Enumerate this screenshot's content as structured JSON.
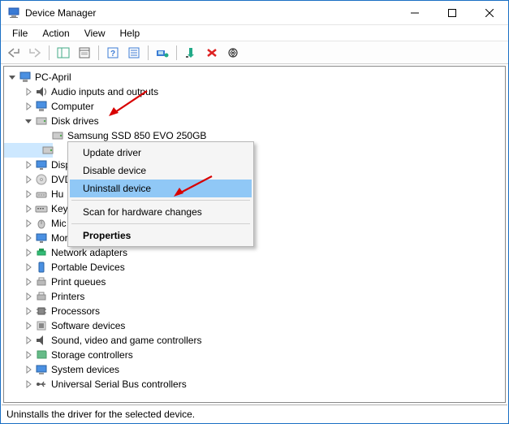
{
  "window": {
    "title": "Device Manager"
  },
  "menu": {
    "file": "File",
    "action": "Action",
    "view": "View",
    "help": "Help"
  },
  "root": {
    "name": "PC-April"
  },
  "categories": [
    {
      "key": "audio",
      "label": "Audio inputs and outputs",
      "expanded": false
    },
    {
      "key": "computer",
      "label": "Computer",
      "expanded": false
    },
    {
      "key": "disk",
      "label": "Disk drives",
      "expanded": true,
      "children": [
        {
          "key": "ssd",
          "label": "Samsung SSD 850 EVO 250GB"
        }
      ]
    },
    {
      "key": "display",
      "label": "Disp",
      "expanded": false,
      "truncated": true
    },
    {
      "key": "dvd",
      "label": "DVD",
      "expanded": false,
      "truncated": true
    },
    {
      "key": "hid",
      "label": "Hu",
      "expanded": false,
      "truncated": true
    },
    {
      "key": "keyboards",
      "label": "Keyb",
      "expanded": false,
      "truncated": true
    },
    {
      "key": "mice",
      "label": "Mic",
      "expanded": false,
      "truncated": true
    },
    {
      "key": "monitors",
      "label": "Mor",
      "expanded": false,
      "truncated": true
    },
    {
      "key": "network",
      "label": "Network adapters",
      "expanded": false
    },
    {
      "key": "portable",
      "label": "Portable Devices",
      "expanded": false
    },
    {
      "key": "printq",
      "label": "Print queues",
      "expanded": false
    },
    {
      "key": "printers",
      "label": "Printers",
      "expanded": false
    },
    {
      "key": "processors",
      "label": "Processors",
      "expanded": false
    },
    {
      "key": "swdev",
      "label": "Software devices",
      "expanded": false
    },
    {
      "key": "svgc",
      "label": "Sound, video and game controllers",
      "expanded": false
    },
    {
      "key": "storage",
      "label": "Storage controllers",
      "expanded": false
    },
    {
      "key": "sysdev",
      "label": "System devices",
      "expanded": false
    },
    {
      "key": "usb",
      "label": "Universal Serial Bus controllers",
      "expanded": false
    }
  ],
  "context_menu": {
    "update": "Update driver",
    "disable": "Disable device",
    "uninstall": "Uninstall device",
    "scan": "Scan for hardware changes",
    "properties": "Properties"
  },
  "status": "Uninstalls the driver for the selected device."
}
